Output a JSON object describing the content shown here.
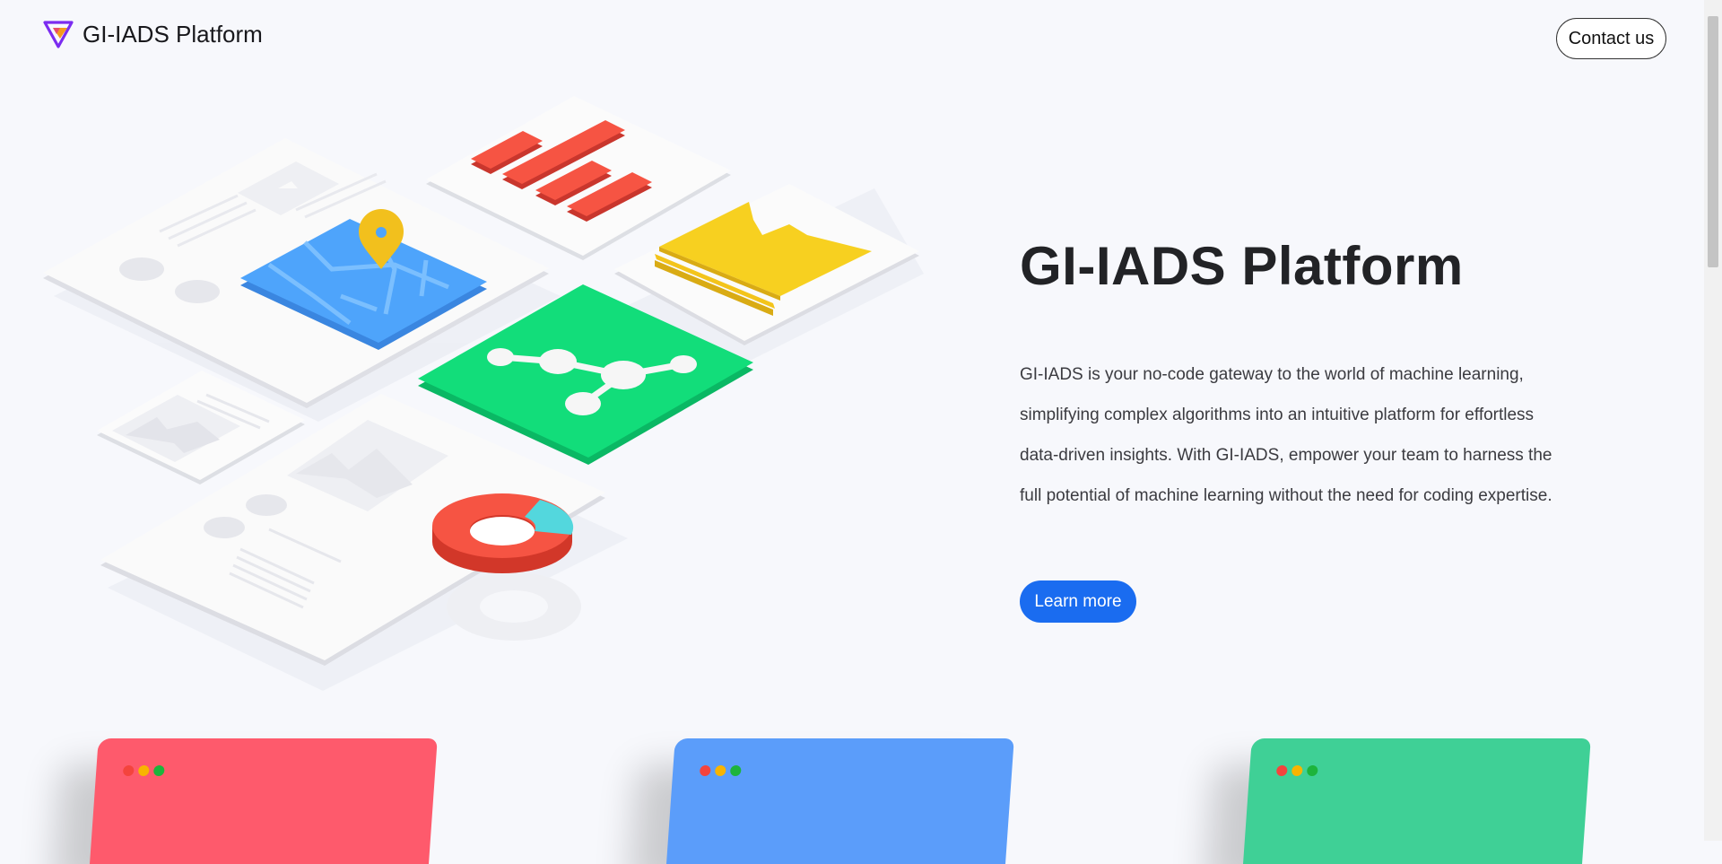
{
  "header": {
    "brand_name": "GI-IADS Platform",
    "logo_icon": "triangle-v-logo",
    "contact_label": "Contact us"
  },
  "hero": {
    "title": "GI-IADS Platform",
    "description": "GI-IADS is your no-code gateway to the world of machine learning, simplifying complex algorithms into an intuitive platform for effortless data-driven insights. With GI-IADS, empower your team to harness the full potential of machine learning without the need for coding expertise.",
    "cta_label": "Learn more",
    "illustration_icon": "isometric-dashboard-illustration"
  },
  "cards": [
    {
      "color": "#fe5a6c",
      "label": ""
    },
    {
      "color": "#5b9dfa",
      "label": ""
    },
    {
      "color": "#3fd096",
      "label": ""
    }
  ],
  "colors": {
    "background": "#f7f8fc",
    "accent": "#1a6cf0",
    "dot_red": "#f4443d",
    "dot_yellow": "#f8b400",
    "dot_green": "#1db43c"
  }
}
